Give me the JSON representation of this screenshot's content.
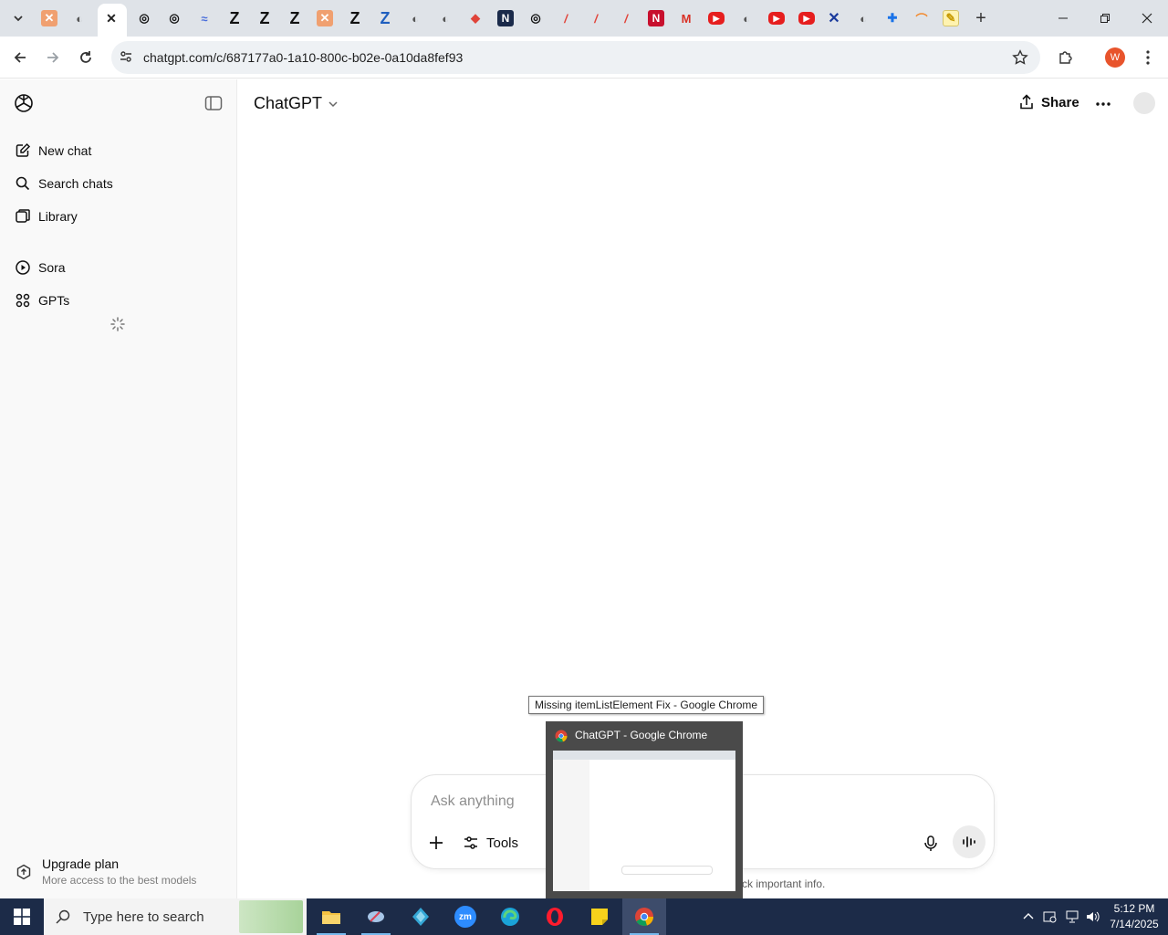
{
  "browser": {
    "url": "chatgpt.com/c/687177a0-1a10-800c-b02e-0a10da8fef93",
    "profile_initial": "W",
    "profile_color": "#e8542c",
    "close_tab_glyph": "✕",
    "new_tab_glyph": "+",
    "tab_favicons": [
      "tab-list-icon",
      "jira-icon",
      "globe-icon",
      "openai-icon",
      "openai-icon",
      "wave-icon",
      "zeta-icon",
      "zeta-icon",
      "zeta-icon",
      "jira-icon",
      "zeta-icon",
      "zeta-icon",
      "globe-icon",
      "globe-icon",
      "sketch-icon",
      "notion-icon",
      "openai-icon",
      "script-icon",
      "script-icon",
      "script-icon",
      "netflix-icon",
      "gmail-icon",
      "youtube-icon",
      "globe-icon",
      "youtube-icon",
      "youtube-icon",
      "x-tool-icon",
      "globe-icon",
      "puzzle-icon",
      "rainbow-icon",
      "note-icon"
    ]
  },
  "sidebar": {
    "items": [
      {
        "label": "New chat",
        "icon": "edit-icon"
      },
      {
        "label": "Search chats",
        "icon": "search-icon"
      },
      {
        "label": "Library",
        "icon": "library-icon"
      },
      {
        "label": "Sora",
        "icon": "play-circle-icon"
      },
      {
        "label": "GPTs",
        "icon": "grid-icon"
      }
    ],
    "upgrade": {
      "title": "Upgrade plan",
      "subtitle": "More access to the best models"
    }
  },
  "main": {
    "model_label": "ChatGPT",
    "share_label": "Share",
    "composer": {
      "placeholder": "Ask anything",
      "tools_label": "Tools"
    },
    "disclaimer_visible": "ck important info."
  },
  "tooltip": {
    "text": "Missing itemListElement Fix - Google Chrome"
  },
  "taskbar_preview": {
    "title": "ChatGPT - Google Chrome"
  },
  "taskbar": {
    "search_placeholder": "Type here to search",
    "time": "5:12 PM",
    "date": "7/14/2025",
    "apps": [
      "file-explorer-icon",
      "paint-icon",
      "app-diamond-icon",
      "zoom-icon",
      "edge-icon",
      "opera-icon",
      "sticky-notes-icon",
      "chrome-icon"
    ]
  }
}
